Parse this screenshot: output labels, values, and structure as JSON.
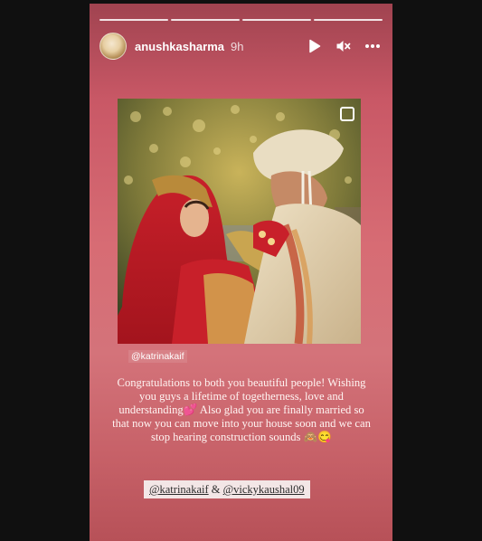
{
  "story": {
    "progress_segments": 4,
    "username": "anushkasharma",
    "time": "9h",
    "controls": {
      "play": "play-icon",
      "mute": "mute-icon",
      "more": "more-icon"
    },
    "photo_mention": "@katrinakaif",
    "caption": "Congratulations to both you beautiful people! Wishing you guys a lifetime of togetherness, love and understanding💕 Also glad you are finally married so that now you can move into your house soon and we can stop hearing construction sounds 🙈😋",
    "tags": {
      "first": "@katrinakaif",
      "separator": " & ",
      "second": "@vickykaushal09"
    }
  },
  "colors": {
    "story_bg_top": "#a04350",
    "story_bg_mid": "#d76c74",
    "tag_bg": "#f3e6e6"
  }
}
